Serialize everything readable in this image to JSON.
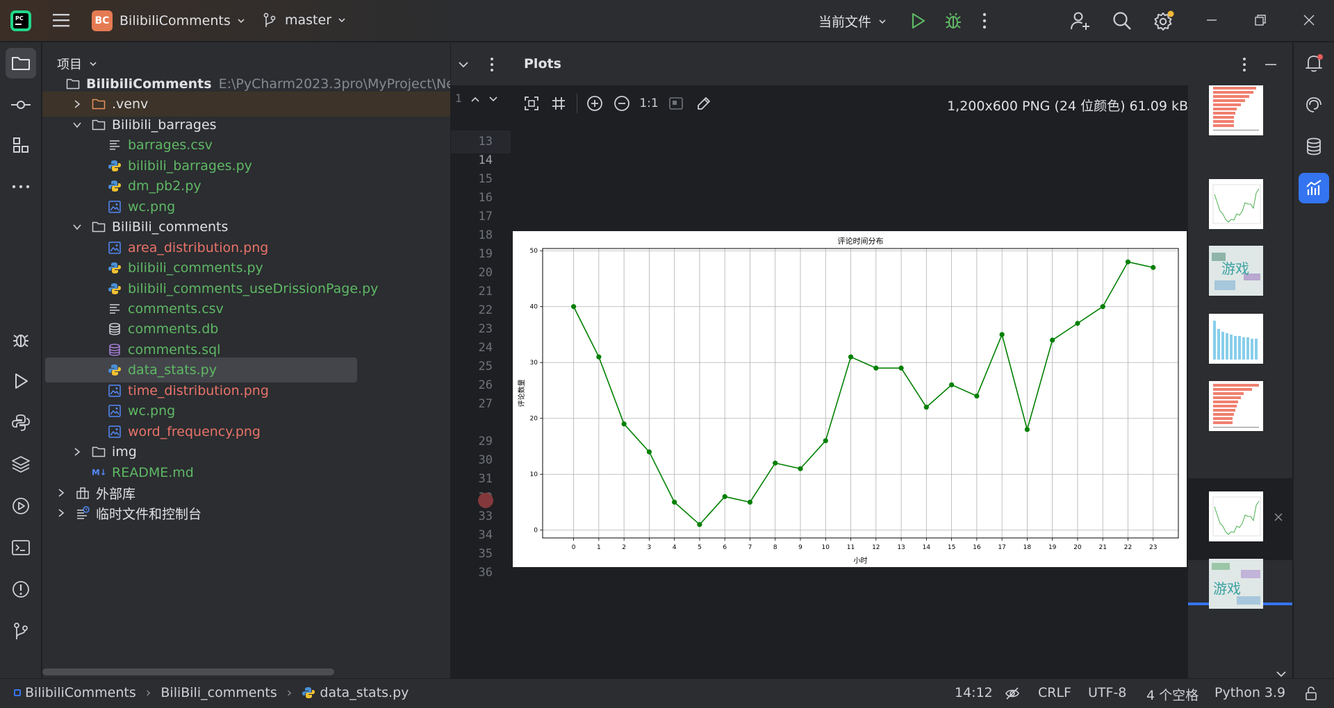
{
  "titlebar": {
    "project_badge": "BC",
    "project_name": "BilibiliComments",
    "branch": "master",
    "run_config": "当前文件"
  },
  "project_panel": {
    "title": "项目",
    "tree": [
      {
        "name": "BilibiliComments",
        "path": "E:\\PyCharm2023.3pro\\MyProject\\Ne",
        "type": "folder",
        "expanded": true
      },
      {
        "name": ".venv",
        "type": "folder-excluded",
        "expanded": false
      },
      {
        "name": "Bilibili_barrages",
        "type": "folder",
        "expanded": true
      },
      {
        "name": "barrages.csv",
        "type": "csv"
      },
      {
        "name": "bilibili_barrages.py",
        "type": "python"
      },
      {
        "name": "dm_pb2.py",
        "type": "python"
      },
      {
        "name": "wc.png",
        "type": "image"
      },
      {
        "name": "BiliBili_comments",
        "type": "folder",
        "expanded": true
      },
      {
        "name": "area_distribution.png",
        "type": "image"
      },
      {
        "name": "bilibili_comments.py",
        "type": "python"
      },
      {
        "name": "bilibili_comments_useDrissionPage.py",
        "type": "python"
      },
      {
        "name": "comments.csv",
        "type": "csv"
      },
      {
        "name": "comments.db",
        "type": "db"
      },
      {
        "name": "comments.sql",
        "type": "sql"
      },
      {
        "name": "data_stats.py",
        "type": "python",
        "selected": true
      },
      {
        "name": "time_distribution.png",
        "type": "image"
      },
      {
        "name": "wc.png",
        "type": "image"
      },
      {
        "name": "word_frequency.png",
        "type": "image"
      },
      {
        "name": "img",
        "type": "folder",
        "expanded": false
      },
      {
        "name": "README.md",
        "type": "markdown"
      },
      {
        "name": "外部库",
        "type": "library",
        "expanded": false
      },
      {
        "name": "临时文件和控制台",
        "type": "scratch",
        "expanded": false
      }
    ]
  },
  "editor": {
    "fold_line": "1",
    "line_numbers": [
      "13",
      "14",
      "15",
      "16",
      "17",
      "18",
      "19",
      "20",
      "21",
      "22",
      "23",
      "24",
      "25",
      "26",
      "27",
      "",
      "29",
      "30",
      "31",
      "32",
      "33",
      "34",
      "35",
      "36"
    ],
    "current_line": "14"
  },
  "plots": {
    "title": "Plots",
    "zoom_label": "1:1",
    "image_info": "1,200x600 PNG (24 位颜色) 61.09 kB"
  },
  "chart_data": {
    "type": "line",
    "title": "评论时间分布",
    "xlabel": "小时",
    "ylabel": "评论数量",
    "x": [
      0,
      1,
      2,
      3,
      4,
      5,
      6,
      7,
      8,
      9,
      10,
      11,
      12,
      13,
      14,
      15,
      16,
      17,
      18,
      19,
      20,
      21,
      22,
      23
    ],
    "values": [
      40,
      31,
      19,
      14,
      5,
      1,
      6,
      5,
      12,
      11,
      16,
      31,
      29,
      29,
      22,
      26,
      24,
      35,
      18,
      34,
      37,
      40,
      48,
      47
    ],
    "ylim": [
      -1.4,
      50.4
    ],
    "yticks": [
      0,
      10,
      20,
      30,
      40,
      50
    ],
    "grid": true,
    "line_color": "#008000"
  },
  "statusbar": {
    "crumbs": [
      "BilibiliComments",
      "BiliBili_comments",
      "data_stats.py"
    ],
    "position": "14:12",
    "line_sep": "CRLF",
    "encoding": "UTF-8",
    "indent": "4 个空格",
    "interpreter": "Python 3.9"
  }
}
